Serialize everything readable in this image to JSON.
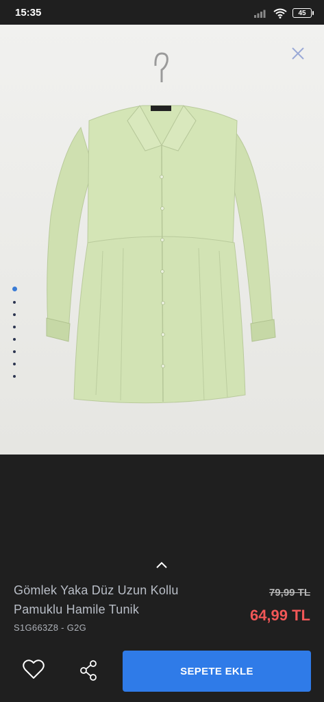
{
  "status_bar": {
    "time": "15:35",
    "battery": "45"
  },
  "product": {
    "title": "Gömlek Yaka Düz Uzun Kollu Pamuklu Hamile Tunik",
    "sku": "S1G663Z8 - G2G",
    "old_price": "79,99 TL",
    "new_price": "64,99 TL",
    "image_count": 8,
    "active_image": 1
  },
  "actions": {
    "add_to_cart_label": "SEPETE EKLE"
  },
  "colors": {
    "accent": "#2f7be8",
    "price": "#f25757",
    "background": "#1f1f1f",
    "shirt": "#cfe0b0"
  },
  "icons": [
    "signal-icon",
    "wifi-icon",
    "battery-icon",
    "close-icon",
    "chevron-up-icon",
    "heart-icon",
    "share-icon"
  ]
}
